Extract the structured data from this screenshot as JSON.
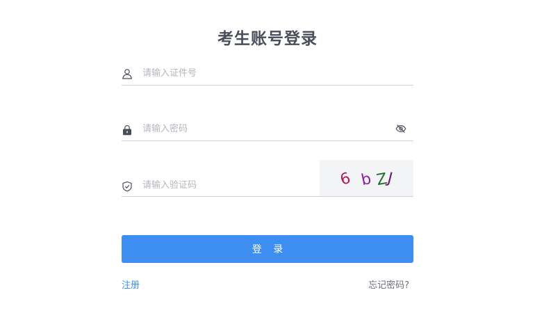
{
  "title": "考生账号登录",
  "account": {
    "placeholder": "请输入证件号",
    "value": "",
    "icon": "user-icon"
  },
  "password": {
    "placeholder": "请输入密码",
    "value": "",
    "icon": "lock-icon",
    "toggle_icon": "eye-off-icon"
  },
  "captcha": {
    "placeholder": "请输入验证码",
    "value": "",
    "icon": "shield-check-icon",
    "image_text": "6 bZJ"
  },
  "login_button": "登 录",
  "register_link": "注册",
  "forgot_link": "忘记密码?",
  "colors": {
    "primary": "#3d8ef0",
    "title": "#4a4e5a",
    "divider": "#cfd2d7",
    "captcha_bg": "#f3f4f5"
  }
}
